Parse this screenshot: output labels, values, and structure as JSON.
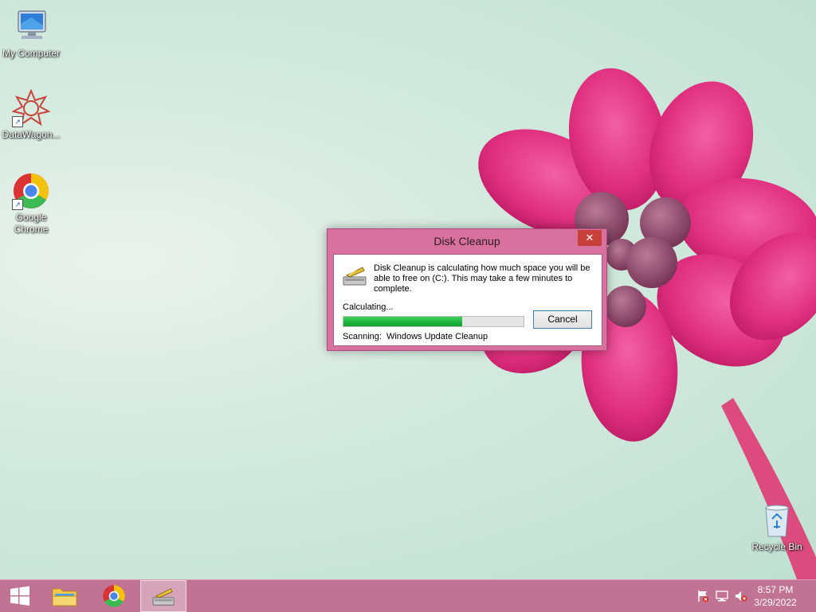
{
  "desktop": {
    "icons": [
      {
        "label": "My Computer",
        "icon": "computer-icon"
      },
      {
        "label": "DataWagon...",
        "icon": "datawagon-icon"
      },
      {
        "label": "Google Chrome",
        "icon": "chrome-icon"
      },
      {
        "label": "Recycle Bin",
        "icon": "recycle-bin-icon"
      }
    ]
  },
  "dialog": {
    "title": "Disk Cleanup",
    "close_glyph": "✕",
    "message": "Disk Cleanup is calculating how much space you will be able to free on  (C:). This may take a few minutes to complete.",
    "status_label": "Calculating...",
    "progress_fraction": 0.66,
    "cancel_label": "Cancel",
    "scanning_label": "Scanning:",
    "scanning_value": "Windows Update Cleanup",
    "icon": "disk-cleanup-icon"
  },
  "taskbar": {
    "items": [
      {
        "icon": "windows-start-icon"
      },
      {
        "icon": "file-explorer-icon"
      },
      {
        "icon": "chrome-icon"
      },
      {
        "icon": "disk-cleanup-icon",
        "active": true
      }
    ],
    "tray": {
      "icons": [
        "action-center-flag-icon",
        "network-icon",
        "volume-muted-icon"
      ],
      "time": "8:57 PM",
      "date": "3/29/2022"
    }
  },
  "colors": {
    "accent": "#d9719f",
    "taskbar": "#c07393",
    "progress": "#1fb03c"
  }
}
